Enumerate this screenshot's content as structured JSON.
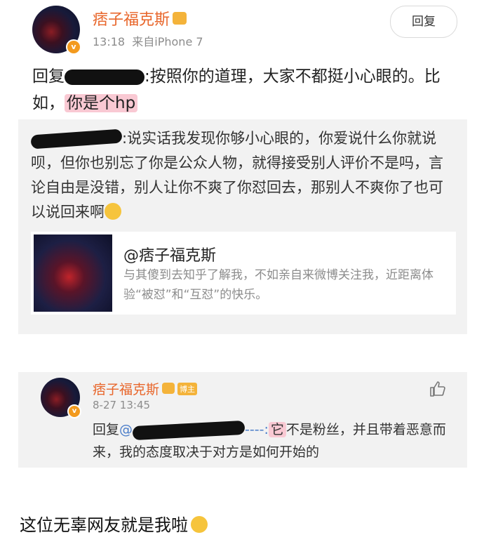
{
  "post": {
    "author": "痞子福克斯",
    "time": "13:18",
    "source": "来自iPhone 7",
    "reply_button": "回复",
    "text_prefix": "回复",
    "text_main": ":按照你的道理，大家不都挺小心眼的。比如，",
    "text_highlight": "你是个hp",
    "verified_badge": "v"
  },
  "quoted": {
    "text": ":说实话我发现你够小心眼的，你爱说什么你就说呗，但你也别忘了你是公众人物，就得接受别人评价不是吗，言论自由是没错，别人让你不爽了你怼回去，那别人不爽你了也可以说回来啊",
    "card": {
      "title": "@痞子福克斯",
      "description": "与其傻到去知乎了解我，不如亲自来微博关注我，近距离体验“被怼”和“互怼”的快乐。"
    }
  },
  "comment": {
    "author": "痞子福克斯",
    "badge": "博主",
    "date": "8-27 13:45",
    "prefix": "回复",
    "at_sign": "@",
    "link_tail": "----:",
    "highlight": "它",
    "text": "不是粉丝，并且带着恶意而来，我的态度取决于对方是如何开始的",
    "like_icon": "thumbs-up-icon"
  },
  "caption": "这位无辜网友就是我啦",
  "colors": {
    "username": "#e8662b",
    "link": "#4a7dc9",
    "highlight": "#f9c9d3",
    "box": "#f2f2f2"
  }
}
